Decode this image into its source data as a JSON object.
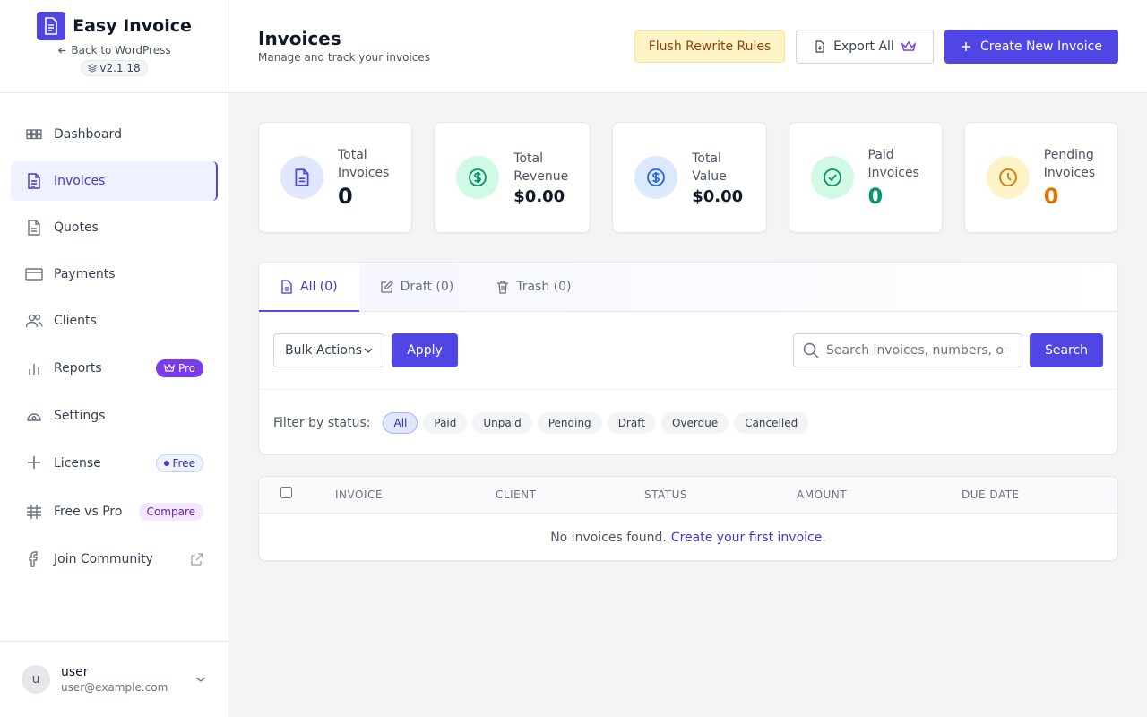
{
  "brand": {
    "name": "Easy Invoice",
    "back_label": "Back to WordPress",
    "version": "v2.1.18"
  },
  "nav": {
    "items": [
      {
        "label": "Dashboard",
        "icon": "grid-icon"
      },
      {
        "label": "Invoices",
        "icon": "document-icon",
        "active": true
      },
      {
        "label": "Quotes",
        "icon": "quote-document-icon"
      },
      {
        "label": "Payments",
        "icon": "credit-card-icon"
      },
      {
        "label": "Clients",
        "icon": "users-icon"
      },
      {
        "label": "Reports",
        "icon": "bar-chart-icon",
        "badge": "Pro"
      },
      {
        "label": "Settings",
        "icon": "settings-icon"
      },
      {
        "label": "License",
        "icon": "sparkle-icon",
        "badge": "Free"
      },
      {
        "label": "Free vs Pro",
        "icon": "grid-lines-icon",
        "badge": "Compare"
      },
      {
        "label": "Join Community",
        "icon": "facebook-icon"
      }
    ]
  },
  "user": {
    "initial": "u",
    "name": "user",
    "email": "user@example.com"
  },
  "header": {
    "title": "Invoices",
    "subtitle": "Manage and track your invoices",
    "flush_label": "Flush Rewrite Rules",
    "export_label": "Export All",
    "create_label": "Create New Invoice"
  },
  "stats": [
    {
      "label": "Total Invoices",
      "value": "0",
      "color": "#111827",
      "icon_bg": "#e0e7ff",
      "icon_color": "#4f46e5"
    },
    {
      "label": "Total Revenue",
      "value": "$0.00",
      "color": "#111827",
      "icon_bg": "#d1fae5",
      "icon_color": "#059669"
    },
    {
      "label": "Total Value",
      "value": "$0.00",
      "color": "#111827",
      "icon_bg": "#dbeafe",
      "icon_color": "#2563eb"
    },
    {
      "label": "Paid Invoices",
      "value": "0",
      "color": "#059669",
      "icon_bg": "#d1fae5",
      "icon_color": "#059669"
    },
    {
      "label": "Pending Invoices",
      "value": "0",
      "color": "#d97706",
      "icon_bg": "#fef3c7",
      "icon_color": "#d97706"
    }
  ],
  "tabs": [
    {
      "label": "All (0)",
      "active": true
    },
    {
      "label": "Draft (0)"
    },
    {
      "label": "Trash (0)"
    }
  ],
  "toolbar": {
    "bulk_label": "Bulk Actions",
    "apply_label": "Apply",
    "search_placeholder": "Search invoices, numbers, or",
    "search_label": "Search"
  },
  "filter": {
    "label": "Filter by status:",
    "chips": [
      "All",
      "Paid",
      "Unpaid",
      "Pending",
      "Draft",
      "Overdue",
      "Cancelled"
    ],
    "active": "All"
  },
  "table": {
    "columns": [
      "INVOICE",
      "CLIENT",
      "STATUS",
      "AMOUNT",
      "DUE DATE"
    ],
    "empty_text": "No invoices found.",
    "empty_link": "Create your first invoice",
    "empty_end": "."
  },
  "colors": {
    "accent": "#4f46e5",
    "pro": "#7c3aed"
  }
}
